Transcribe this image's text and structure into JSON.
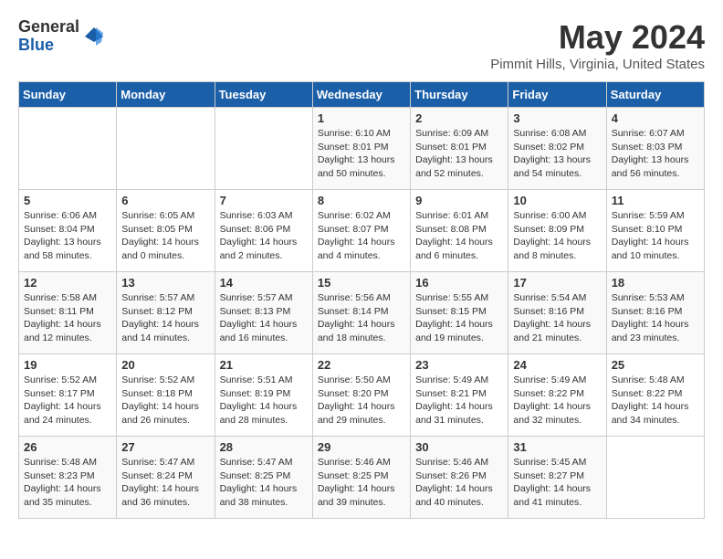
{
  "logo": {
    "general": "General",
    "blue": "Blue"
  },
  "header": {
    "month": "May 2024",
    "location": "Pimmit Hills, Virginia, United States"
  },
  "weekdays": [
    "Sunday",
    "Monday",
    "Tuesday",
    "Wednesday",
    "Thursday",
    "Friday",
    "Saturday"
  ],
  "weeks": [
    [
      {
        "date": "",
        "info": ""
      },
      {
        "date": "",
        "info": ""
      },
      {
        "date": "",
        "info": ""
      },
      {
        "date": "1",
        "info": "Sunrise: 6:10 AM\nSunset: 8:01 PM\nDaylight: 13 hours\nand 50 minutes."
      },
      {
        "date": "2",
        "info": "Sunrise: 6:09 AM\nSunset: 8:01 PM\nDaylight: 13 hours\nand 52 minutes."
      },
      {
        "date": "3",
        "info": "Sunrise: 6:08 AM\nSunset: 8:02 PM\nDaylight: 13 hours\nand 54 minutes."
      },
      {
        "date": "4",
        "info": "Sunrise: 6:07 AM\nSunset: 8:03 PM\nDaylight: 13 hours\nand 56 minutes."
      }
    ],
    [
      {
        "date": "5",
        "info": "Sunrise: 6:06 AM\nSunset: 8:04 PM\nDaylight: 13 hours\nand 58 minutes."
      },
      {
        "date": "6",
        "info": "Sunrise: 6:05 AM\nSunset: 8:05 PM\nDaylight: 14 hours\nand 0 minutes."
      },
      {
        "date": "7",
        "info": "Sunrise: 6:03 AM\nSunset: 8:06 PM\nDaylight: 14 hours\nand 2 minutes."
      },
      {
        "date": "8",
        "info": "Sunrise: 6:02 AM\nSunset: 8:07 PM\nDaylight: 14 hours\nand 4 minutes."
      },
      {
        "date": "9",
        "info": "Sunrise: 6:01 AM\nSunset: 8:08 PM\nDaylight: 14 hours\nand 6 minutes."
      },
      {
        "date": "10",
        "info": "Sunrise: 6:00 AM\nSunset: 8:09 PM\nDaylight: 14 hours\nand 8 minutes."
      },
      {
        "date": "11",
        "info": "Sunrise: 5:59 AM\nSunset: 8:10 PM\nDaylight: 14 hours\nand 10 minutes."
      }
    ],
    [
      {
        "date": "12",
        "info": "Sunrise: 5:58 AM\nSunset: 8:11 PM\nDaylight: 14 hours\nand 12 minutes."
      },
      {
        "date": "13",
        "info": "Sunrise: 5:57 AM\nSunset: 8:12 PM\nDaylight: 14 hours\nand 14 minutes."
      },
      {
        "date": "14",
        "info": "Sunrise: 5:57 AM\nSunset: 8:13 PM\nDaylight: 14 hours\nand 16 minutes."
      },
      {
        "date": "15",
        "info": "Sunrise: 5:56 AM\nSunset: 8:14 PM\nDaylight: 14 hours\nand 18 minutes."
      },
      {
        "date": "16",
        "info": "Sunrise: 5:55 AM\nSunset: 8:15 PM\nDaylight: 14 hours\nand 19 minutes."
      },
      {
        "date": "17",
        "info": "Sunrise: 5:54 AM\nSunset: 8:16 PM\nDaylight: 14 hours\nand 21 minutes."
      },
      {
        "date": "18",
        "info": "Sunrise: 5:53 AM\nSunset: 8:16 PM\nDaylight: 14 hours\nand 23 minutes."
      }
    ],
    [
      {
        "date": "19",
        "info": "Sunrise: 5:52 AM\nSunset: 8:17 PM\nDaylight: 14 hours\nand 24 minutes."
      },
      {
        "date": "20",
        "info": "Sunrise: 5:52 AM\nSunset: 8:18 PM\nDaylight: 14 hours\nand 26 minutes."
      },
      {
        "date": "21",
        "info": "Sunrise: 5:51 AM\nSunset: 8:19 PM\nDaylight: 14 hours\nand 28 minutes."
      },
      {
        "date": "22",
        "info": "Sunrise: 5:50 AM\nSunset: 8:20 PM\nDaylight: 14 hours\nand 29 minutes."
      },
      {
        "date": "23",
        "info": "Sunrise: 5:49 AM\nSunset: 8:21 PM\nDaylight: 14 hours\nand 31 minutes."
      },
      {
        "date": "24",
        "info": "Sunrise: 5:49 AM\nSunset: 8:22 PM\nDaylight: 14 hours\nand 32 minutes."
      },
      {
        "date": "25",
        "info": "Sunrise: 5:48 AM\nSunset: 8:22 PM\nDaylight: 14 hours\nand 34 minutes."
      }
    ],
    [
      {
        "date": "26",
        "info": "Sunrise: 5:48 AM\nSunset: 8:23 PM\nDaylight: 14 hours\nand 35 minutes."
      },
      {
        "date": "27",
        "info": "Sunrise: 5:47 AM\nSunset: 8:24 PM\nDaylight: 14 hours\nand 36 minutes."
      },
      {
        "date": "28",
        "info": "Sunrise: 5:47 AM\nSunset: 8:25 PM\nDaylight: 14 hours\nand 38 minutes."
      },
      {
        "date": "29",
        "info": "Sunrise: 5:46 AM\nSunset: 8:25 PM\nDaylight: 14 hours\nand 39 minutes."
      },
      {
        "date": "30",
        "info": "Sunrise: 5:46 AM\nSunset: 8:26 PM\nDaylight: 14 hours\nand 40 minutes."
      },
      {
        "date": "31",
        "info": "Sunrise: 5:45 AM\nSunset: 8:27 PM\nDaylight: 14 hours\nand 41 minutes."
      },
      {
        "date": "",
        "info": ""
      }
    ]
  ]
}
